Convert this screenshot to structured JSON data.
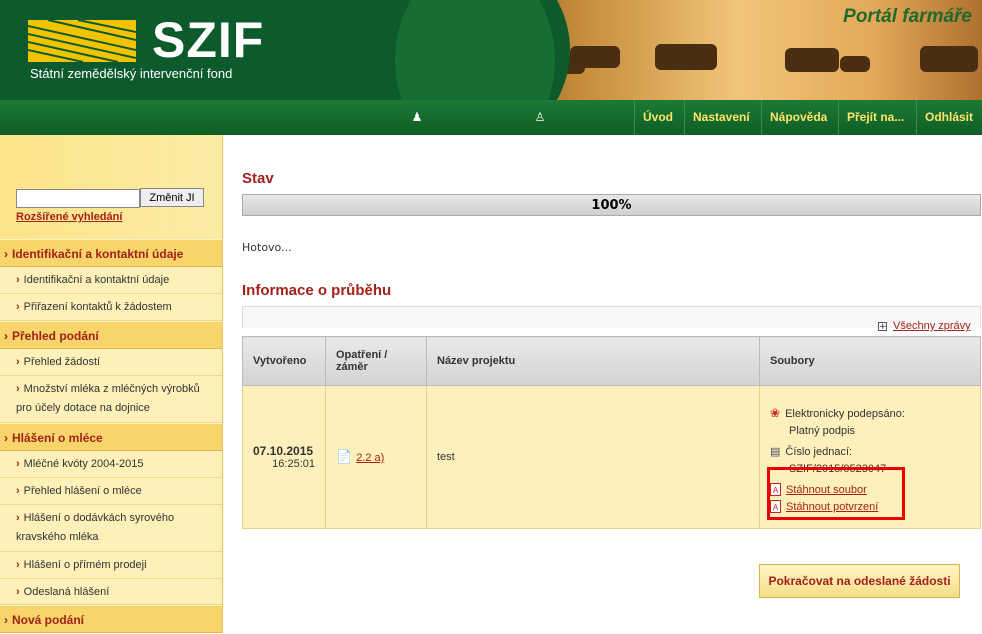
{
  "header": {
    "logo": "SZIF",
    "subtitle": "Státní zemědělský intervenční fond",
    "portal": "Portál farmáře",
    "colors": {
      "green": "#0d5a2c",
      "nav_text": "#ffe36a",
      "accent": "#a3211b",
      "highlight": "#e00000"
    }
  },
  "nav": {
    "icons": [
      "farmer-icon",
      "user-icon"
    ],
    "items": [
      "Úvod",
      "Nastavení",
      "Nápověda",
      "Přejít na...",
      "Odhlásit"
    ]
  },
  "sidebar": {
    "search": {
      "value": "",
      "button": "Změnit JI",
      "advanced": "Rozšířené vyhledání"
    },
    "sections": [
      {
        "title": "Identifikační a kontaktní údaje"
      },
      {
        "title": "Přehled podání"
      },
      {
        "title": "Hlášení o mléce"
      },
      {
        "title": "Nová podání"
      }
    ],
    "links": [
      "Identifikační a kontaktní údaje",
      "Přiřazení kontaktů k žádostem",
      "Přehled žádostí",
      "Množství mléka z mléčných výrobků pro účely dotace na dojnice",
      "Mléčné kvóty 2004-2015",
      "Přehled hlášení o mléce",
      "Hlášení o dodávkách syrového kravského mléka",
      "Hlášení o přímém prodeji",
      "Odeslaná hlášení"
    ]
  },
  "main": {
    "status_title": "Stav",
    "progress": {
      "value": 100,
      "label": "100%"
    },
    "status_text": "Hotovo...",
    "info_title": "Informace o průběhu",
    "all_messages": "Všechny zprávy",
    "table": {
      "headers": [
        "Vytvořeno",
        "Opatření / záměr",
        "Název projektu",
        "Soubory"
      ],
      "row": {
        "date": "07.10.2015",
        "time": "16:25:01",
        "measure": "2.2 a)",
        "project": "test",
        "signed_label": "Elektronicky podepsáno:",
        "signed_value": "Platný podpis",
        "ref_label": "Číslo jednací:",
        "ref_value": "SZIF/2015/0523047",
        "download_file": "Stáhnout soubor",
        "download_confirm": "Stáhnout potvrzení"
      }
    },
    "continue_button": "Pokračovat na odeslané žádosti"
  }
}
